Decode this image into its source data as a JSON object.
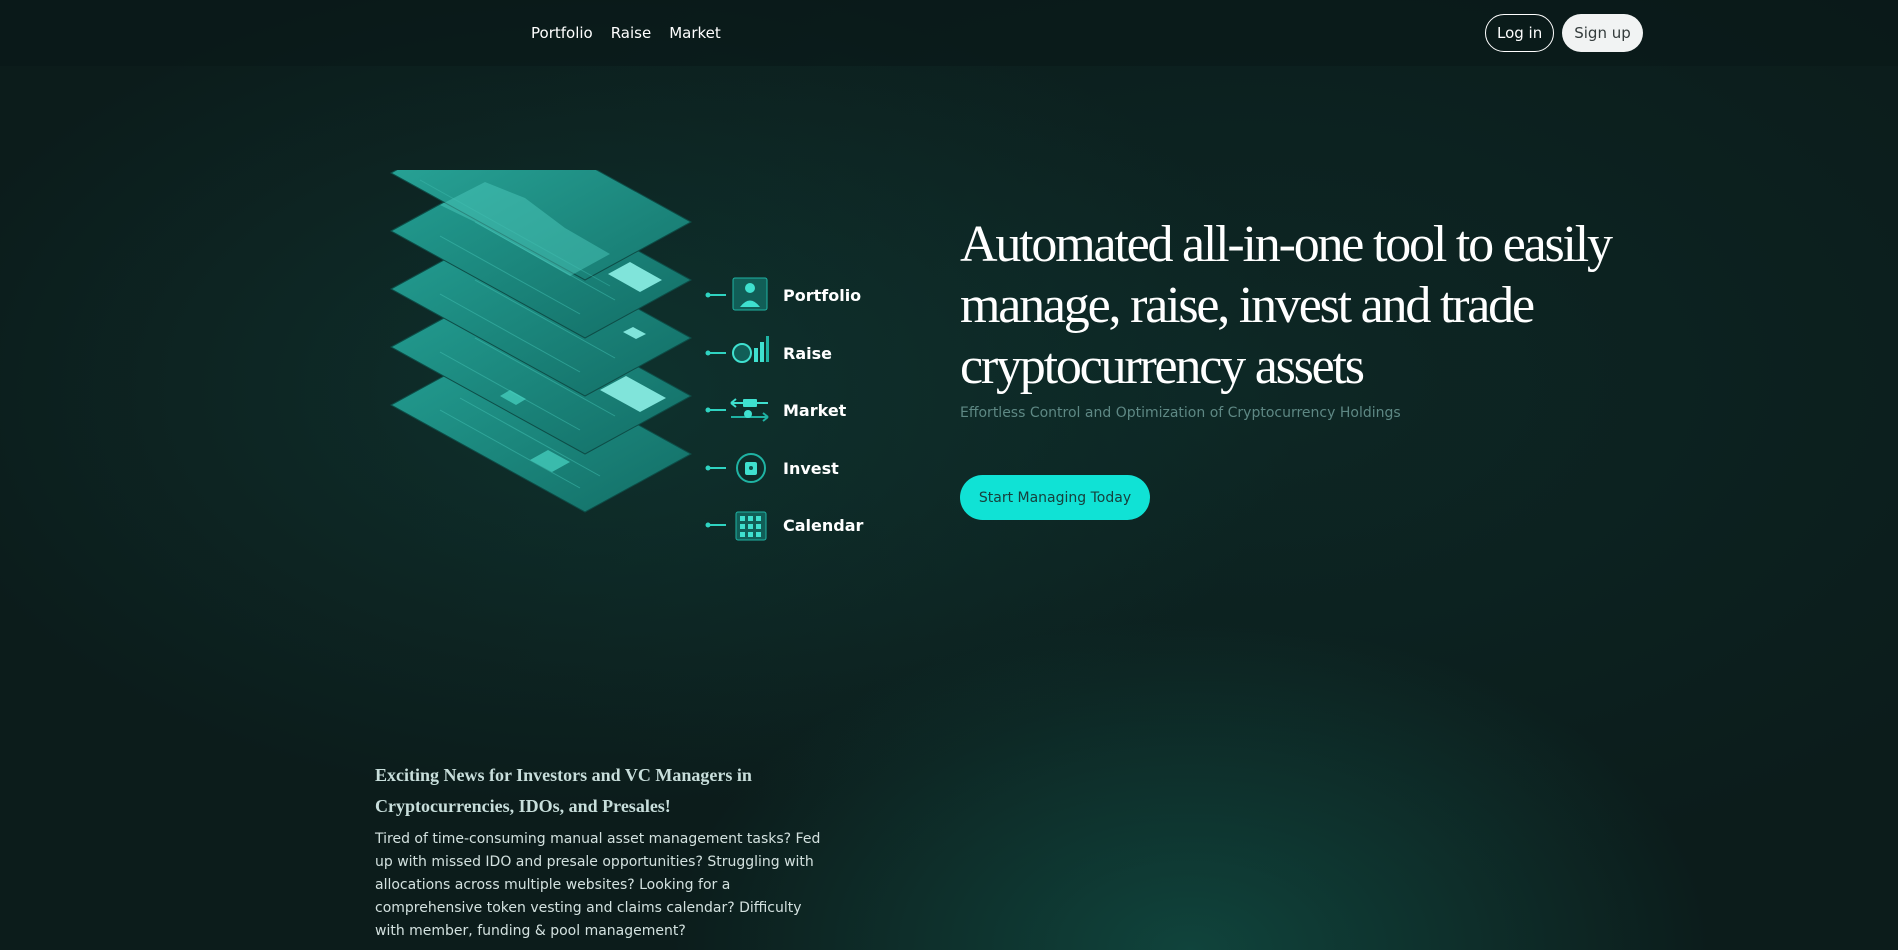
{
  "nav": {
    "links": [
      "Portfolio",
      "Raise",
      "Market"
    ]
  },
  "auth": {
    "login_label": "Log in",
    "signup_label": "Sign up"
  },
  "hero": {
    "features": [
      "Portfolio",
      "Raise",
      "Market",
      "Invest",
      "Calendar"
    ],
    "title": "Automated all-in-one tool to easily manage, raise, invest and trade cryptocurrency assets",
    "subtitle": "Effortless Control and Optimization of Cryptocurrency Holdings",
    "cta_label": "Start Managing Today"
  },
  "news": {
    "title": "Exciting News for Investors and VC Managers in Cryptocurrencies, IDOs, and Presales!",
    "body": "Tired of time-consuming manual asset management tasks? Fed up with missed IDO and presale opportunities? Struggling with allocations across multiple websites? Looking for a comprehensive token vesting and claims calendar? Difficulty with member, funding & pool management?"
  },
  "colors": {
    "background": "#0c1c1b",
    "accent": "#10e2d5",
    "subtitle": "#5e8884",
    "layer": "#1a8f83"
  },
  "icons": [
    "portfolio-icon",
    "raise-icon",
    "market-icon",
    "invest-icon",
    "calendar-icon"
  ]
}
